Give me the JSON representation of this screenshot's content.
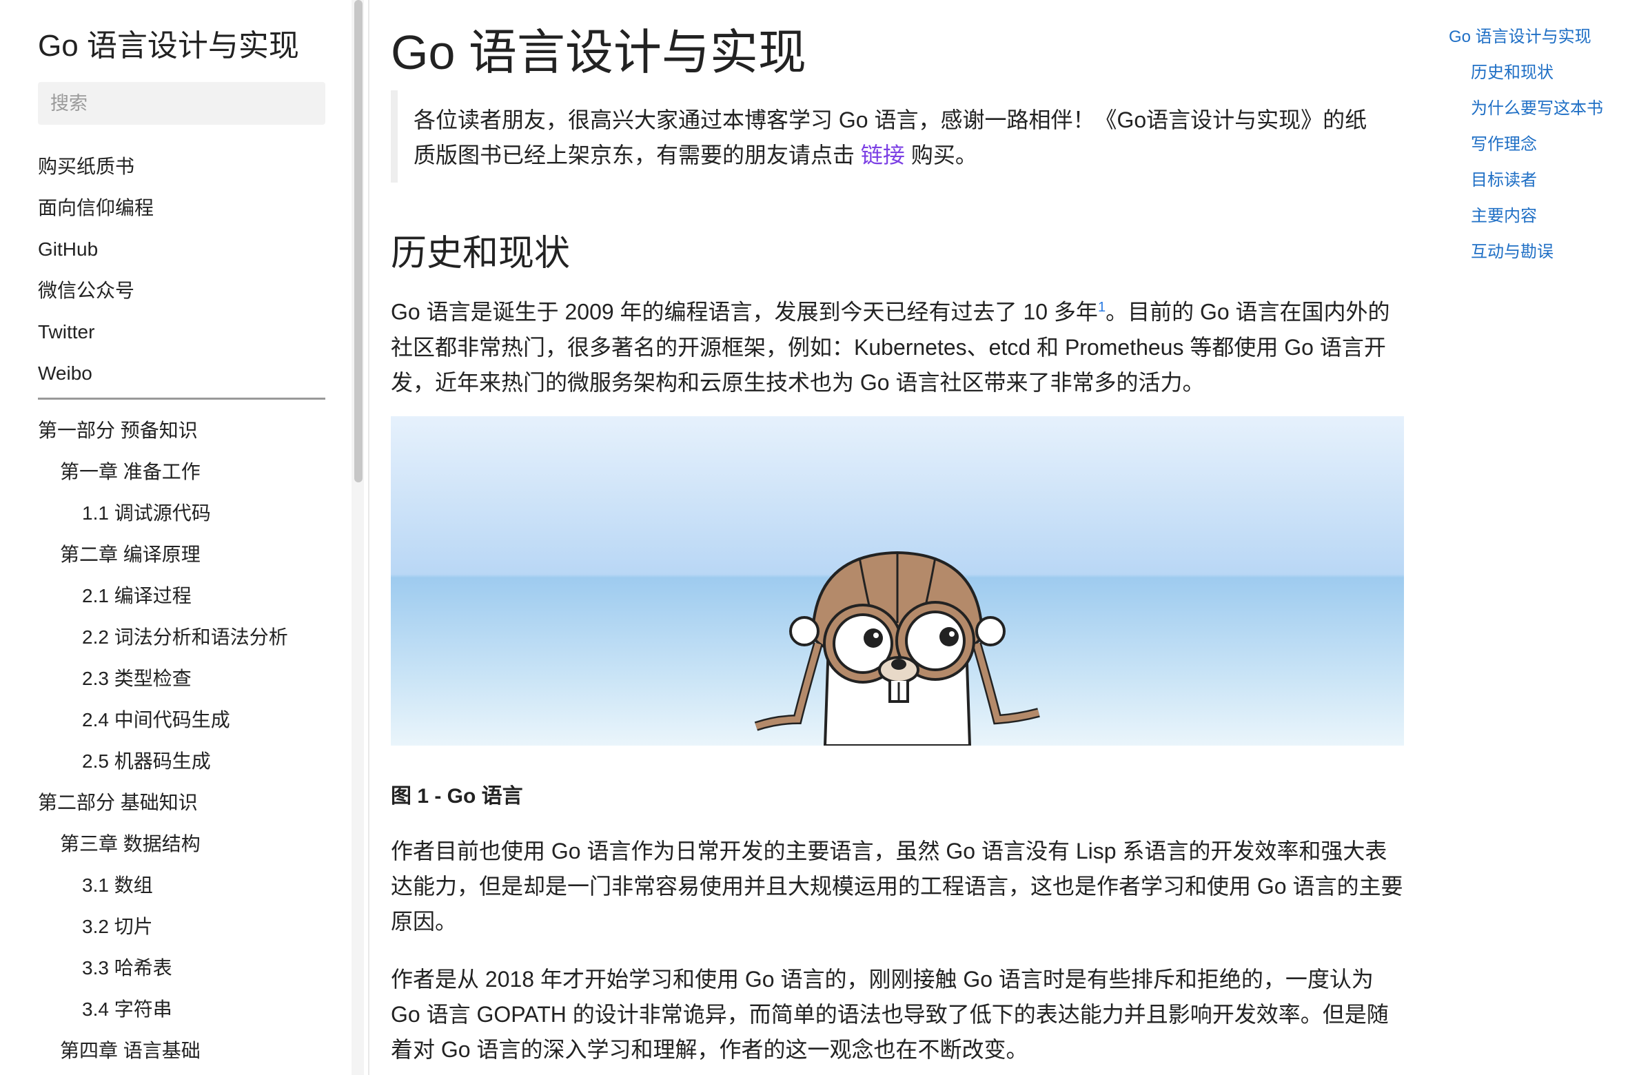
{
  "sidebar": {
    "site_title": "Go 语言设计与实现",
    "search_placeholder": "搜索",
    "links": [
      "购买纸质书",
      "面向信仰编程",
      "GitHub",
      "微信公众号",
      "Twitter",
      "Weibo"
    ],
    "toc": [
      {
        "label": "第一部分 预备知识",
        "level": 1
      },
      {
        "label": "第一章 准备工作",
        "level": 2
      },
      {
        "label": "1.1 调试源代码",
        "level": 3
      },
      {
        "label": "第二章 编译原理",
        "level": 2
      },
      {
        "label": "2.1 编译过程",
        "level": 3
      },
      {
        "label": "2.2 词法分析和语法分析",
        "level": 3
      },
      {
        "label": "2.3 类型检查",
        "level": 3
      },
      {
        "label": "2.4 中间代码生成",
        "level": 3
      },
      {
        "label": "2.5 机器码生成",
        "level": 3
      },
      {
        "label": "第二部分 基础知识",
        "level": 1
      },
      {
        "label": "第三章 数据结构",
        "level": 2
      },
      {
        "label": "3.1 数组",
        "level": 3
      },
      {
        "label": "3.2 切片",
        "level": 3
      },
      {
        "label": "3.3 哈希表",
        "level": 3
      },
      {
        "label": "3.4 字符串",
        "level": 3
      },
      {
        "label": "第四章 语言基础",
        "level": 2
      }
    ]
  },
  "main": {
    "title": "Go 语言设计与实现",
    "notice": {
      "line1": "各位读者朋友，很高兴大家通过本博客学习 Go 语言，感谢一路相伴！《Go语言设计与实现》的纸",
      "line2_before": "质版图书已经上架京东，有需要的朋友请点击 ",
      "link_text": "链接",
      "line2_after": " 购买。"
    },
    "section_title": "历史和现状",
    "p1_before": "Go 语言是诞生于 2009 年的编程语言，发展到今天已经有过去了 10 多年",
    "p1_footnote": "1",
    "p1_after": "。目前的 Go 语言在国内外的社区都非常热门，很多著名的开源框架，例如：Kubernetes、etcd 和 Prometheus 等都使用 Go 语言开发，近年来热门的微服务架构和云原生技术也为 Go 语言社区带来了非常多的活力。",
    "figure_caption": "图 1 - Go 语言",
    "p2": "作者目前也使用 Go 语言作为日常开发的主要语言，虽然 Go 语言没有 Lisp 系语言的开发效率和强大表达能力，但是却是一门非常容易使用并且大规模运用的工程语言，这也是作者学习和使用 Go 语言的主要原因。",
    "p3": "作者是从 2018 年才开始学习和使用 Go 语言的，刚刚接触 Go 语言时是有些排斥和拒绝的，一度认为 Go 语言 GOPATH 的设计非常诡异，而简单的语法也导致了低下的表达能力并且影响开发效率。但是随着对 Go 语言的深入学习和理解，作者的这一观念也在不断改变。"
  },
  "right_toc": {
    "items": [
      {
        "label": "Go 语言设计与实现",
        "sub": false
      },
      {
        "label": "历史和现状",
        "sub": true
      },
      {
        "label": "为什么要写这本书",
        "sub": true
      },
      {
        "label": "写作理念",
        "sub": true
      },
      {
        "label": "目标读者",
        "sub": true
      },
      {
        "label": "主要内容",
        "sub": true
      },
      {
        "label": "互动与勘误",
        "sub": true
      }
    ]
  },
  "colors": {
    "link_accent": "#7b3fe4",
    "toc_link": "#1f6fc5",
    "text": "#222222"
  }
}
